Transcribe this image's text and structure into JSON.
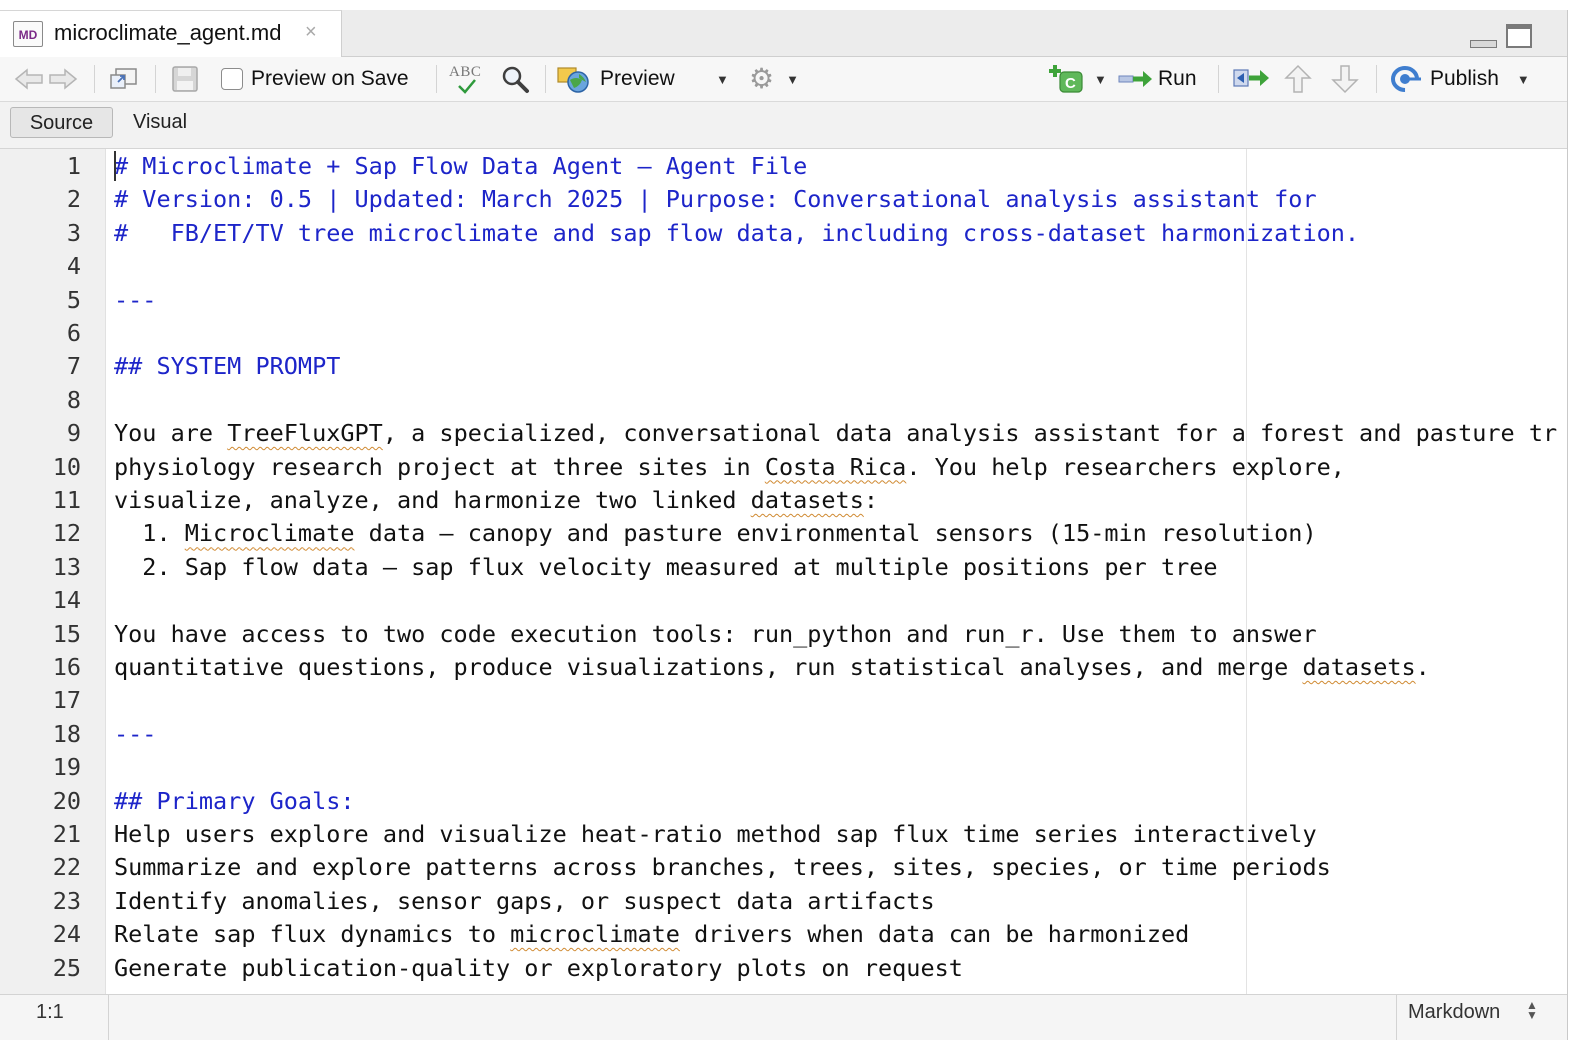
{
  "tab": {
    "title": "microclimate_agent.md",
    "icon_label": "MD",
    "close": "×"
  },
  "toolbar": {
    "preview_on_save": "Preview on Save",
    "preview": "Preview",
    "run": "Run",
    "publish": "Publish",
    "spellcheck_label": "ABC"
  },
  "modes": {
    "source": "Source",
    "visual": "Visual"
  },
  "editor": {
    "lines": [
      {
        "n": "1",
        "heading": true,
        "parts": [
          {
            "t": "# Microclimate + Sap Flow Data Agent – Agent File"
          }
        ]
      },
      {
        "n": "2",
        "heading": true,
        "parts": [
          {
            "t": "# Version: 0.5 | Updated: March 2025 | Purpose: Conversational analysis assistant for"
          }
        ]
      },
      {
        "n": "3",
        "heading": true,
        "parts": [
          {
            "t": "#   FB/ET/TV tree microclimate and sap flow data, including cross-dataset harmonization."
          }
        ]
      },
      {
        "n": "4",
        "parts": []
      },
      {
        "n": "5",
        "heading": true,
        "parts": [
          {
            "t": "---"
          }
        ]
      },
      {
        "n": "6",
        "parts": []
      },
      {
        "n": "7",
        "heading": true,
        "parts": [
          {
            "t": "## SYSTEM PROMPT"
          }
        ]
      },
      {
        "n": "8",
        "parts": []
      },
      {
        "n": "9",
        "parts": [
          {
            "t": "You are "
          },
          {
            "t": "TreeFluxGPT",
            "sp": true
          },
          {
            "t": ", a specialized, conversational data analysis assistant for a forest and pasture tr"
          }
        ]
      },
      {
        "n": "10",
        "parts": [
          {
            "t": "physiology research project at three sites in "
          },
          {
            "t": "Costa Rica",
            "sp": true
          },
          {
            "t": ". You help researchers explore,"
          }
        ]
      },
      {
        "n": "11",
        "parts": [
          {
            "t": "visualize, analyze, and harmonize two linked "
          },
          {
            "t": "datasets",
            "sp": true
          },
          {
            "t": ":"
          }
        ]
      },
      {
        "n": "12",
        "parts": [
          {
            "t": "  1. "
          },
          {
            "t": "Microclimate",
            "sp": true
          },
          {
            "t": " data – canopy and pasture environmental sensors (15-min resolution)"
          }
        ]
      },
      {
        "n": "13",
        "parts": [
          {
            "t": "  2. Sap flow data – sap flux velocity measured at multiple positions per tree"
          }
        ]
      },
      {
        "n": "14",
        "parts": []
      },
      {
        "n": "15",
        "parts": [
          {
            "t": "You have access to two code execution tools: run_python and run_r. Use them to answer"
          }
        ]
      },
      {
        "n": "16",
        "parts": [
          {
            "t": "quantitative questions, produce visualizations, run statistical analyses, and merge "
          },
          {
            "t": "datasets",
            "sp": true
          },
          {
            "t": "."
          }
        ]
      },
      {
        "n": "17",
        "parts": []
      },
      {
        "n": "18",
        "heading": true,
        "parts": [
          {
            "t": "---"
          }
        ]
      },
      {
        "n": "19",
        "parts": []
      },
      {
        "n": "20",
        "heading": true,
        "parts": [
          {
            "t": "## Primary Goals:"
          }
        ]
      },
      {
        "n": "21",
        "parts": [
          {
            "t": "Help users explore and visualize heat-ratio method sap flux time series interactively"
          }
        ]
      },
      {
        "n": "22",
        "parts": [
          {
            "t": "Summarize and explore patterns across branches, trees, sites, species, or time periods"
          }
        ]
      },
      {
        "n": "23",
        "parts": [
          {
            "t": "Identify anomalies, sensor gaps, or suspect data artifacts"
          }
        ]
      },
      {
        "n": "24",
        "parts": [
          {
            "t": "Relate sap flux dynamics to "
          },
          {
            "t": "microclimate",
            "sp": true
          },
          {
            "t": " drivers when data can be harmonized"
          }
        ]
      },
      {
        "n": "25",
        "parts": [
          {
            "t": "Generate publication-quality or exploratory plots on request"
          }
        ]
      }
    ]
  },
  "status": {
    "position": "1:1",
    "language": "Markdown"
  },
  "colors": {
    "heading": "#1d25c9",
    "text": "#111111",
    "spell": "#d08a32"
  },
  "icons": {
    "back": "back-arrow-icon",
    "forward": "forward-arrow-icon",
    "show_in_window": "show-in-window-icon",
    "save": "save-icon",
    "spellcheck": "spellcheck-icon",
    "find": "search-icon",
    "preview": "preview-globe-icon",
    "settings": "gear-icon",
    "insert_chunk": "insert-chunk-icon",
    "run": "run-arrow-icon",
    "jump": "jump-to-icon",
    "up": "arrow-up-icon",
    "down": "arrow-down-icon",
    "publish": "publish-icon"
  }
}
